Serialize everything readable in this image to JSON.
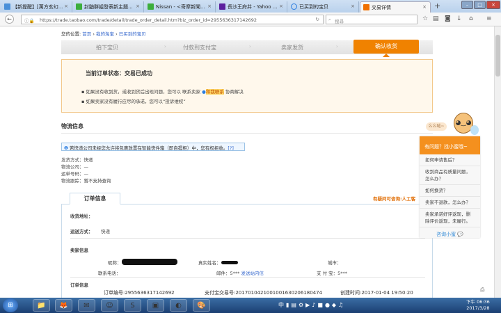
{
  "browser": {
    "tabs": [
      {
        "label": "【新提醒】[萬方玄幻...",
        "color": "#4a90d9"
      },
      {
        "label": "封鼬群組發表新主題...",
        "color": "#3cae3c"
      },
      {
        "label": "Nissan - <奇摩新聞...",
        "color": "#3cae3c"
      },
      {
        "label": "長沙王府井 - Yahoo ...",
        "color": "#5c1f9e"
      },
      {
        "label": "已买到的宝贝",
        "color": "#2b7de0"
      },
      {
        "label": "交易详情",
        "color": "#f07000"
      }
    ],
    "url": "https://trade.taobao.com/trade/detail/trade_order_detail.htm?biz_order_id=2955636317142692",
    "search_placeholder": "搜尋"
  },
  "breadcrumb": {
    "label": "您的位置:",
    "items": [
      "首页",
      "我的淘宝",
      "已买到的宝贝"
    ]
  },
  "steps": [
    "拍下宝贝",
    "付款到支付宝",
    "卖家发货",
    "确认收货"
  ],
  "status": {
    "title": "当前订单状态：交易已成功",
    "line1_a": "如果没有收到货，或收到货后出现问题，您可以 联系卖家",
    "line1_link": "和我联系",
    "line1_b": "协商解决",
    "line2": "如果卖家没有履行应尽的承诺，您可以“投诉维权”"
  },
  "logistics": {
    "title": "物流信息",
    "notice": "若快递公司未经您允许将包裹放置在智能快件箱（即自提柜）中，您有权拒收。",
    "notice_help": "[?]",
    "rows": [
      "发货方式：快递",
      "物流公司：—",
      "运单号码：—",
      "物流跟踪：暂不支持查询"
    ]
  },
  "order": {
    "tab": "订单信息",
    "help_link": "有疑问可咨询:人工客",
    "address_label": "收货地址：",
    "shipping_label": "运送方式：",
    "shipping_value": "快递",
    "seller_title": "卖家信息",
    "nickname_label": "昵称：",
    "realname_label": "真实姓名：",
    "city_label": "城市：",
    "phone_label": "联系电话：",
    "email_label": "邮件：",
    "email_value": "5***",
    "send_msg": "发送站内信",
    "alipay_label": "支 付 宝：",
    "alipay_value": "5***",
    "order_title": "订单信息",
    "order_no": "订单编号:2955636317142692",
    "alipay_no": "支付宝交易号:2017010421001001630206180474",
    "created": "创建时间:2017-01-04 19:50:20"
  },
  "helper": {
    "bubble": "么么哒~",
    "header": "有问题？找小蜜哦~",
    "items": [
      "如何申请售后？",
      "收到商品有质量问题，怎么办？",
      "如何换货？",
      "卖家不退款，怎么办？",
      "卖家承诺好评返现，删除评价返现，未履行。"
    ],
    "consult": "咨询小蜜"
  },
  "taskbar": {
    "time": "下午 06:36",
    "date": "2017/3/28"
  }
}
